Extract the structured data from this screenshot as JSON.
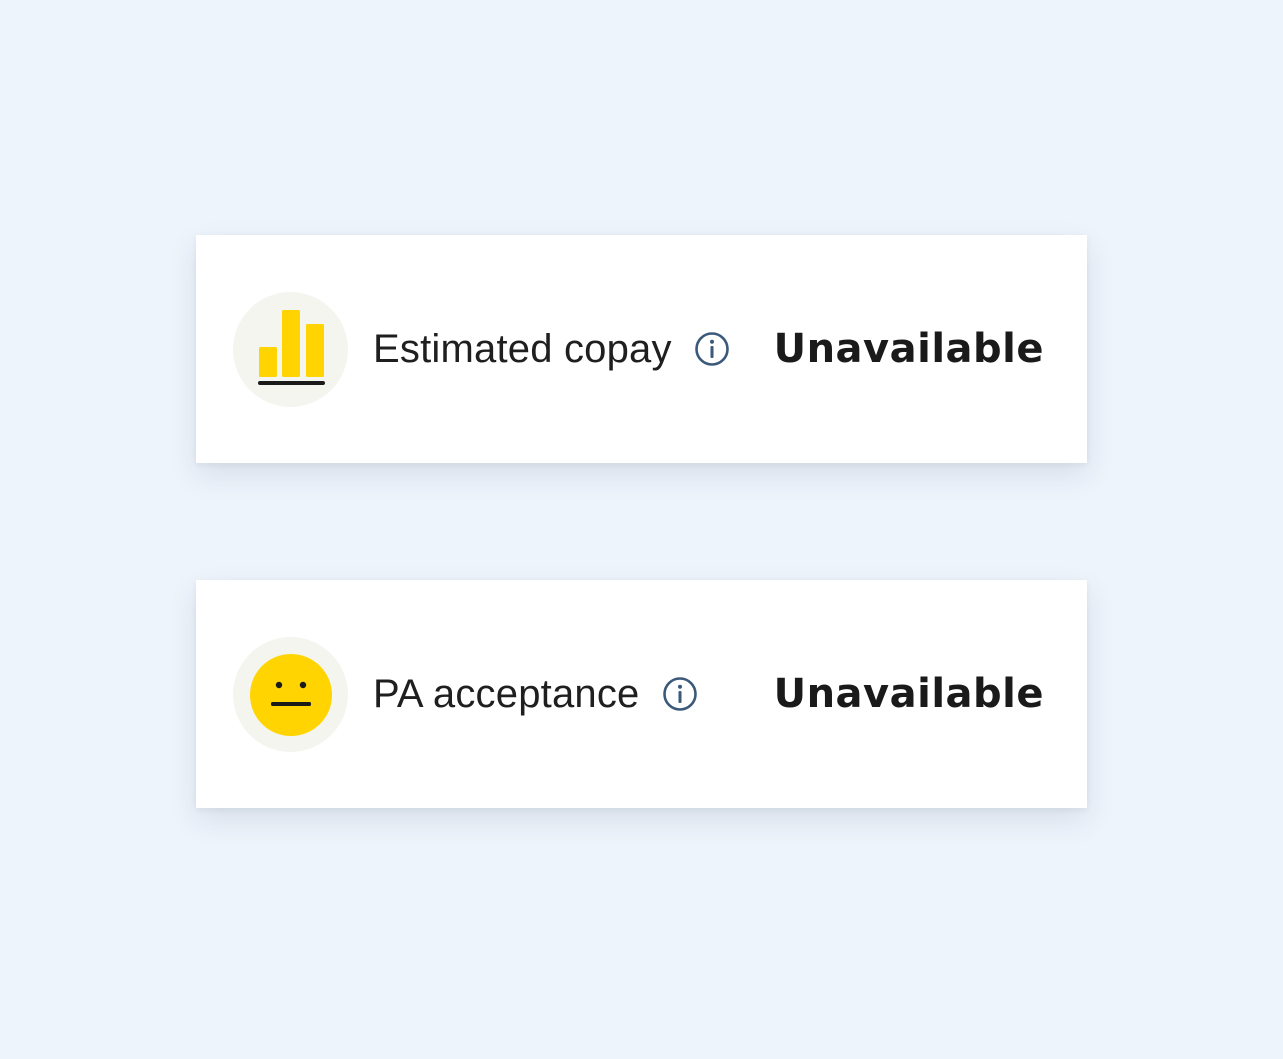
{
  "colors": {
    "background": "#eef4fc",
    "card": "#ffffff",
    "accent_yellow": "#ffd400",
    "icon_bg": "#f5f5f0",
    "info_icon": "#3b5a7a",
    "text": "#1f1f1f"
  },
  "rows": [
    {
      "icon": "bar-chart-icon",
      "label": "Estimated copay",
      "info_icon": "info-icon",
      "value": "Unavailable"
    },
    {
      "icon": "neutral-face-icon",
      "label": "PA acceptance",
      "info_icon": "info-icon",
      "value": "Unavailable"
    }
  ]
}
